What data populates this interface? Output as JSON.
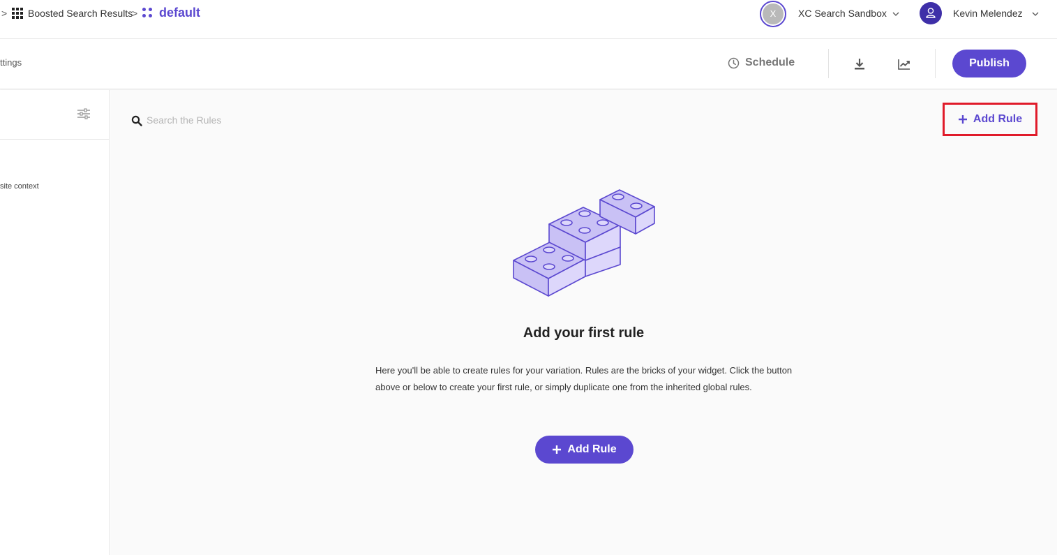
{
  "breadcrumb": {
    "separator": ">",
    "widget_label": "Boosted Search Results",
    "variation_label": "default"
  },
  "account": {
    "tenant_initial": "X",
    "tenant_name": "XC Search Sandbox",
    "user_name": "Kevin Melendez"
  },
  "toolbar": {
    "settings_tab_label": "ttings",
    "schedule_label": "Schedule",
    "publish_label": "Publish"
  },
  "sidebar": {
    "context_text": "site context"
  },
  "main": {
    "search_placeholder": "Search the Rules",
    "add_rule_top_label": "Add Rule",
    "empty_title": "Add your first rule",
    "empty_description": "Here you'll be able to create rules for your variation. Rules are the bricks of your widget. Click the button above or below to create your first rule, or simply duplicate one from the inherited global rules.",
    "add_rule_bottom_label": "Add Rule"
  },
  "colors": {
    "accent": "#5b48d0",
    "highlight_border": "#e01b2a"
  }
}
